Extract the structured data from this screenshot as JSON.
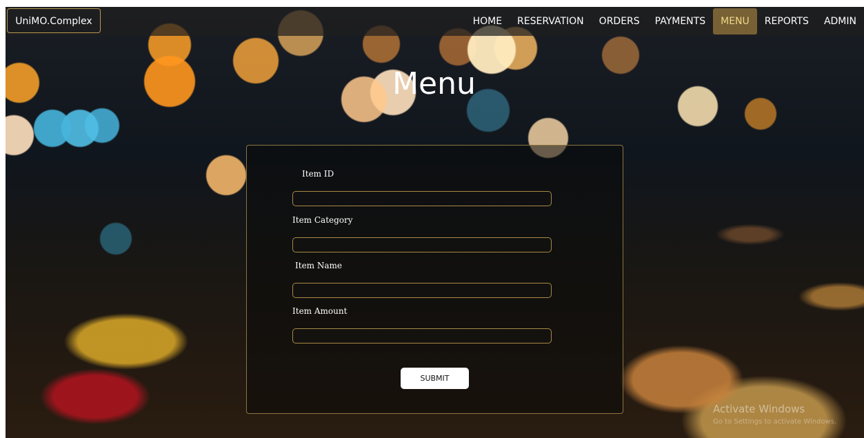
{
  "brand": "UniMO.Complex",
  "nav": {
    "items": [
      {
        "label": "HOME",
        "active": false
      },
      {
        "label": "RESERVATION",
        "active": false
      },
      {
        "label": "ORDERS",
        "active": false
      },
      {
        "label": "PAYMENTS",
        "active": false
      },
      {
        "label": "MENU",
        "active": true
      },
      {
        "label": "REPORTS",
        "active": false
      },
      {
        "label": "ADMIN",
        "active": false
      }
    ]
  },
  "page": {
    "title": "Menu"
  },
  "form": {
    "fields": [
      {
        "label": "Item  ID",
        "value": "",
        "placeholder": ""
      },
      {
        "label": "Item  Category",
        "value": "",
        "placeholder": ""
      },
      {
        "label": "Item  Name",
        "value": "",
        "placeholder": ""
      },
      {
        "label": "Item  Amount",
        "value": "",
        "placeholder": ""
      }
    ],
    "submit_label": "SUBMIT"
  },
  "watermark": {
    "title": "Activate Windows",
    "subtitle": "Go to Settings to activate Windows."
  },
  "colors": {
    "accent_border": "#b79a54",
    "active_nav_bg": "#96783c",
    "active_nav_text": "#f0d68a"
  }
}
